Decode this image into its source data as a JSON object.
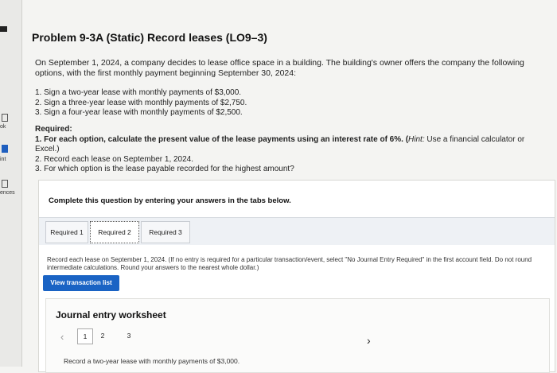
{
  "sidebar": {
    "labels": [
      "ok",
      "int",
      "ences"
    ]
  },
  "problem": {
    "title": "Problem 9-3A (Static) Record leases (LO9–3)",
    "intro": "On September 1, 2024, a company decides to lease office space in a building. The building's owner offers the company the following options, with the first monthly payment beginning September 30, 2024:",
    "options": [
      "1. Sign a two-year lease with monthly payments of $3,000.",
      "2. Sign a three-year lease with monthly payments of $2,750.",
      "3. Sign a four-year lease with monthly payments of $2,500."
    ],
    "required_heading": "Required:",
    "required_1_a": "1. For each option, calculate the present value of the lease payments using an interest rate of 6%. (",
    "required_1_hint": "Hint:",
    "required_1_b": " Use a financial calculator or Excel.)",
    "required_2": "2. Record each lease on September 1, 2024.",
    "required_3": "3. For which option is the lease payable recorded for the highest amount?"
  },
  "panel": {
    "complete_text": "Complete this question by entering your answers in the tabs below.",
    "tabs": [
      {
        "label": "Required 1"
      },
      {
        "label": "Required 2"
      },
      {
        "label": "Required 3"
      }
    ],
    "active_tab": "Required 2",
    "instruction": "Record each lease on September 1, 2024. (If no entry is required for a particular transaction/event, select \"No Journal Entry Required\" in the first account field. Do not round intermediate calculations. Round your answers to the nearest whole dollar.)",
    "view_button": "View transaction list",
    "worksheet": {
      "title": "Journal entry worksheet",
      "pages": [
        "1",
        "2",
        "3"
      ],
      "current_page": "1",
      "prev_icon": "‹",
      "next_icon": "›",
      "description": "Record a two-year lease with monthly payments of $3,000."
    }
  }
}
